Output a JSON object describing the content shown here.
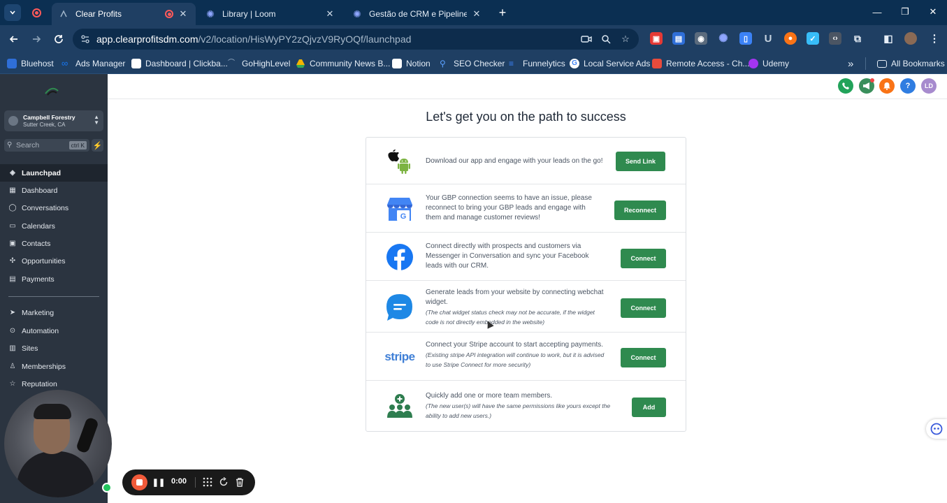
{
  "browser": {
    "tabs": [
      {
        "title": "Clear Profits"
      },
      {
        "title": "Library | Loom"
      },
      {
        "title": "Gestão de CRM e Pipelines com"
      }
    ],
    "url_host": "app.clearprofitsdm.com",
    "url_path": "/v2/location/HisWyPY2zQjvzV9RyOQf/launchpad",
    "bookmarks": [
      {
        "label": "Bluehost",
        "color": "#2f6fd8"
      },
      {
        "label": "Ads Manager",
        "color": "#1877f2"
      },
      {
        "label": "Dashboard | Clickba...",
        "color": "#ffffff"
      },
      {
        "label": "GoHighLevel",
        "color": "#1f3f63"
      },
      {
        "label": "Community News B...",
        "color": "#f4b400"
      },
      {
        "label": "Notion",
        "color": "#ffffff"
      },
      {
        "label": "SEO Checker",
        "color": "#5aa0ff"
      },
      {
        "label": "Funnelytics",
        "color": "#3b82f6"
      },
      {
        "label": "Local Service Ads",
        "color": "#ffffff"
      },
      {
        "label": "Remote Access - Ch...",
        "color": "#e84b3c"
      },
      {
        "label": "Udemy",
        "color": "#a435f0"
      }
    ],
    "all_bookmarks": "All Bookmarks",
    "overflow": "»"
  },
  "sidebar": {
    "location_name": "Campbell Forestry",
    "location_city": "Sutter Creek, CA",
    "search_placeholder": "Search",
    "search_shortcut": "ctrl K",
    "items_top": [
      {
        "label": "Launchpad",
        "icon": "rocket-icon"
      },
      {
        "label": "Dashboard",
        "icon": "grid-icon"
      },
      {
        "label": "Conversations",
        "icon": "chat-icon"
      },
      {
        "label": "Calendars",
        "icon": "calendar-icon"
      },
      {
        "label": "Contacts",
        "icon": "contacts-icon"
      },
      {
        "label": "Opportunities",
        "icon": "opportunities-icon"
      },
      {
        "label": "Payments",
        "icon": "payments-icon"
      }
    ],
    "items_bottom": [
      {
        "label": "Marketing",
        "icon": "send-icon"
      },
      {
        "label": "Automation",
        "icon": "automation-icon"
      },
      {
        "label": "Sites",
        "icon": "sites-icon"
      },
      {
        "label": "Memberships",
        "icon": "memberships-icon"
      },
      {
        "label": "Reputation",
        "icon": "reputation-icon"
      }
    ]
  },
  "topbar": {
    "avatar_initials": "LD",
    "help_glyph": "?"
  },
  "launchpad": {
    "heading": "Let's get you on the path to success",
    "rows": [
      {
        "icon": "mobile-apps-icon",
        "text": "Download our app and engage with your leads on the go!",
        "note": "",
        "button": "Send Link"
      },
      {
        "icon": "google-business-icon",
        "text": "Your GBP connection seems to have an issue, please reconnect to bring your GBP leads and engage with them and manage customer reviews!",
        "note": "",
        "button": "Reconnect"
      },
      {
        "icon": "facebook-icon",
        "text": "Connect directly with prospects and customers via Messenger in Conversation and sync your Facebook leads with our CRM.",
        "note": "",
        "button": "Connect"
      },
      {
        "icon": "webchat-icon",
        "text": "Generate leads from your website by connecting webchat widget.",
        "note": "(The chat widget status check may not be accurate, if the widget code is not directly embedded in the website)",
        "button": "Connect"
      },
      {
        "icon": "stripe-icon",
        "text": "Connect your Stripe account to start accepting payments.",
        "note": "(Existing stripe API integration will continue to work, but it is advised to use Stripe Connect for more security)",
        "button": "Connect"
      },
      {
        "icon": "team-icon",
        "text": "Quickly add one or more team members.",
        "note": "(The new user(s) will have the same permissions like yours except the ability to add new users.)",
        "button": "Add"
      }
    ]
  },
  "stripe_wordmark": "stripe",
  "loom": {
    "timer": "0:00"
  },
  "colors": {
    "sidebar_bg": "#2b3440",
    "button_green": "#2f8a4f",
    "browser_chrome": "#1f3f63"
  }
}
